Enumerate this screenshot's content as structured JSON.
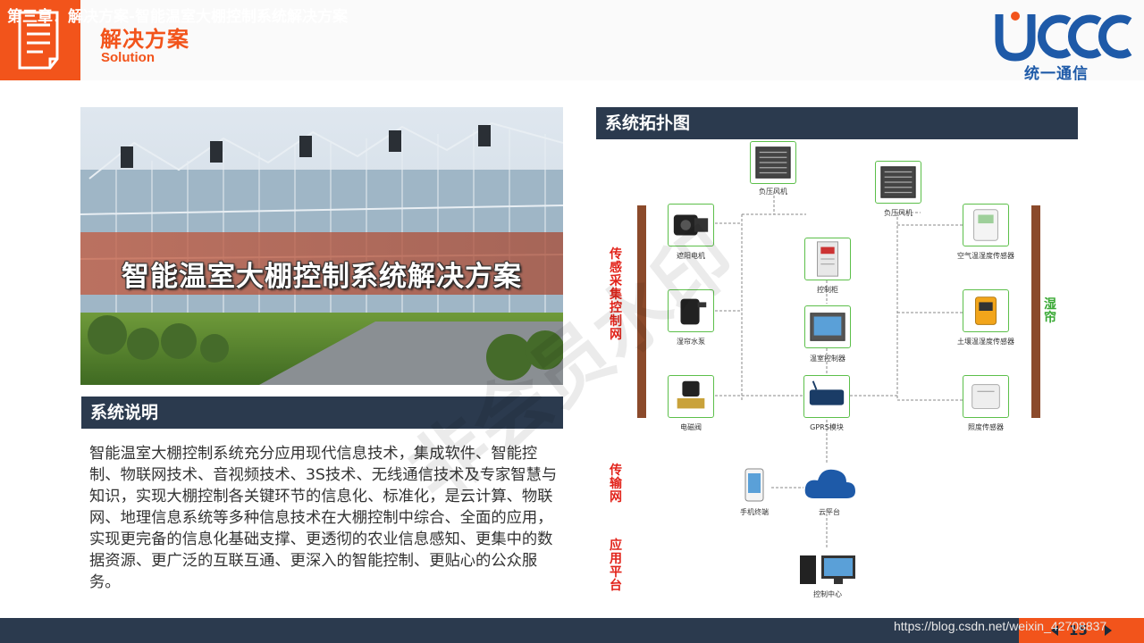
{
  "header": {
    "title": "解决方案",
    "subtitle": "Solution",
    "logo_text": "统一通信",
    "logo_letters": "UCCC",
    "accent": "#f2541b",
    "logo_color": "#1e5aa8"
  },
  "hero": {
    "caption": "智能温室大棚控制系统解决方案"
  },
  "description": {
    "heading": "系统说明",
    "body": "智能温室大棚控制系统充分应用现代信息技术，集成软件、智能控制、物联网技术、音视频技术、3S技术、无线通信技术及专家智慧与知识，实现大棚控制各关键环节的信息化、标准化，是云计算、物联网、地理信息系统等多种信息技术在大棚控制中综合、全面的应用，实现更完备的信息化基础支撑、更透彻的农业信息感知、更集中的数据资源、更广泛的互联互通、更深入的智能控制、更贴心的公众服务。"
  },
  "topology": {
    "heading": "系统拓扑图",
    "side_labels": {
      "sensing": "传感采集控制网",
      "transport": "传输网",
      "application": "应用平台",
      "curtain": "湿帘"
    },
    "devices": {
      "fan1": "负压风机",
      "fan2": "负压风机",
      "shade_motor": "遮阳电机",
      "cabinet": "控制柜",
      "air_sensor": "空气温湿度传感器",
      "pump": "湿帘水泵",
      "greenhouse_ctrl": "温室控制器",
      "soil_sensor": "土壤温湿度传感器",
      "valve": "电磁阀",
      "gprs": "GPRS模块",
      "light_sensor": "照度传感器",
      "phone": "手机终端",
      "cloud": "云平台",
      "center": "控制中心"
    }
  },
  "footer": {
    "text": "第三章：解决方案-智能温室大棚控制系统解决方案",
    "page": "15",
    "url": "https://blog.csdn.net/weixin_42708837",
    "watermark": "非会员水印"
  }
}
